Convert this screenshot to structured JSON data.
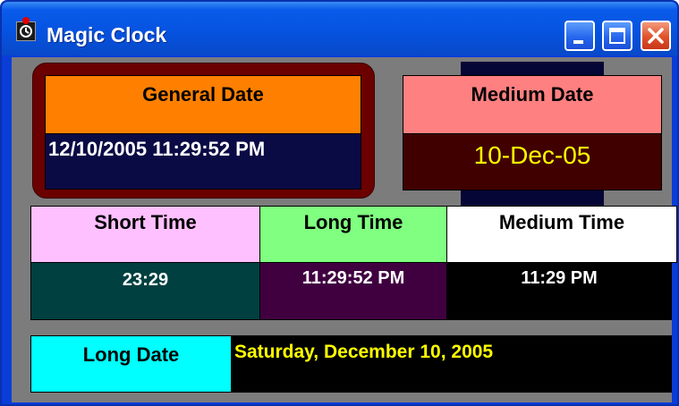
{
  "window": {
    "title": "Magic Clock",
    "app_icon": "clock-app-icon"
  },
  "titlebar_buttons": {
    "minimize": "minimize-icon",
    "maximize": "maximize-icon",
    "close": "close-icon"
  },
  "general_date": {
    "label": "General Date",
    "value": "12/10/2005 11:29:52 PM",
    "label_bg": "#ff8000",
    "value_bg": "#0a0a45",
    "value_color": "#ffffff"
  },
  "medium_date": {
    "label": "Medium Date",
    "value": "10-Dec-05",
    "label_bg": "#ff8080",
    "value_bg": "#400000",
    "value_color": "#ffff00"
  },
  "short_time": {
    "label": "Short Time",
    "value": "23:29",
    "label_bg": "#ffc0ff",
    "value_bg": "#004040",
    "value_color": "#ffffff"
  },
  "long_time": {
    "label": "Long Time",
    "value": "11:29:52 PM",
    "label_bg": "#80ff80",
    "value_bg": "#400040",
    "value_color": "#ffffff"
  },
  "medium_time": {
    "label": "Medium Time",
    "value": "11:29 PM",
    "label_bg": "#ffffff",
    "value_bg": "#000000",
    "value_color": "#ffffff"
  },
  "long_date": {
    "label": "Long Date",
    "value": "Saturday, December 10, 2005",
    "label_bg": "#00ffff",
    "value_bg": "#000000",
    "value_color": "#ffff00"
  }
}
